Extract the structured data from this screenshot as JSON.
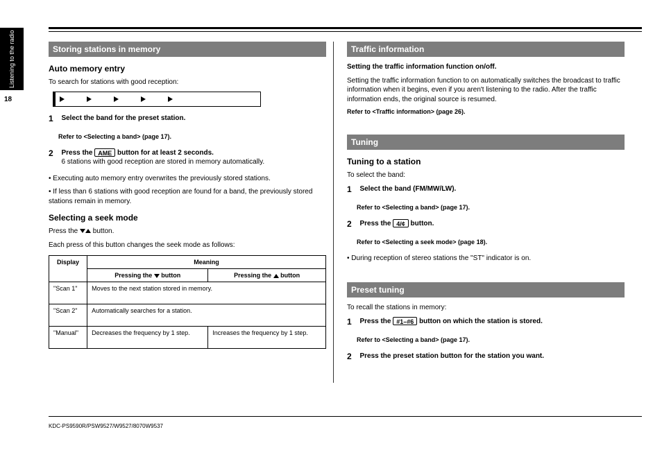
{
  "pageNumber": "18",
  "tabLabel": "Listening to the radio",
  "left": {
    "bar": "Storing stations in memory",
    "autoMemory": {
      "title": "Auto memory entry",
      "lead": "To search for stations with good reception:",
      "step1_num": "1",
      "step1": "Select the band for the preset station.",
      "ref": "Refer to <Selecting a band> (page 17).",
      "step2_num": "2",
      "step2_a": "Press the ",
      "step2_key": "AME",
      "step2_b": " button for at least 2 seconds.",
      "step2_note": "6 stations with good reception are stored in memory automatically.",
      "note1": "• Executing auto memory entry overwrites the previously stored stations.",
      "note2": "• If less than 6 stations with good reception are found for a band, the previously stored stations remain in memory."
    },
    "seek": {
      "title": "Selecting a seek mode",
      "lead_a": "Press the ",
      "lead_b": " button.",
      "lead2": "Each press of this button changes the seek mode as follows:",
      "table": {
        "headers": [
          "Display",
          "Meaning"
        ],
        "subheaders_left": "Pressing the ",
        "subheaders_right": " button",
        "rows": [
          [
            "\"Scan 1\"",
            "Moves to the next station stored in memory.",
            ""
          ],
          [
            "\"Scan 2\"",
            "Automatically searches for a station.",
            ""
          ],
          [
            "\"Manual\"",
            "Decreases the frequency by 1 step.",
            "Increases the frequency by 1 step."
          ]
        ]
      }
    }
  },
  "right": {
    "block1": {
      "bar": "Traffic information",
      "lead": "Setting the traffic information function on/off.",
      "note": "Setting the traffic information function to on automatically switches the broadcast to traffic information when it begins, even if you aren't listening to the radio. After the traffic information ends, the original source is resumed.",
      "ref": "Refer to <Traffic information> (page 26)."
    },
    "block2": {
      "bar": "Tuning",
      "title": "Tuning to a station",
      "lead": "To select the band:",
      "step1_num": "1",
      "step1": "Select the band (FM/MW/LW).",
      "ref1": "Refer to <Selecting a band> (page 17).",
      "step2_num": "2",
      "step2_a": "Press the ",
      "step2_key": "4/¢",
      "step2_b": " button.",
      "ref2": "Refer to <Selecting a seek mode> (page 18).",
      "note": "• During reception of stereo stations the \"ST\" indicator is on."
    },
    "block3": {
      "bar": "Preset tuning",
      "lead": "To recall the stations in memory:",
      "step1_num": "1",
      "step1_a": "Press the ",
      "step1_key": "#1–#6",
      "step1_b": " button on which the station is stored.",
      "ref": "Refer to <Selecting a band> (page 17).",
      "step2_num": "2",
      "step2": "Press the preset station button for the station you want."
    }
  },
  "footer": "KDC-PS9590R/PSW9527/W9527/8070W9537"
}
